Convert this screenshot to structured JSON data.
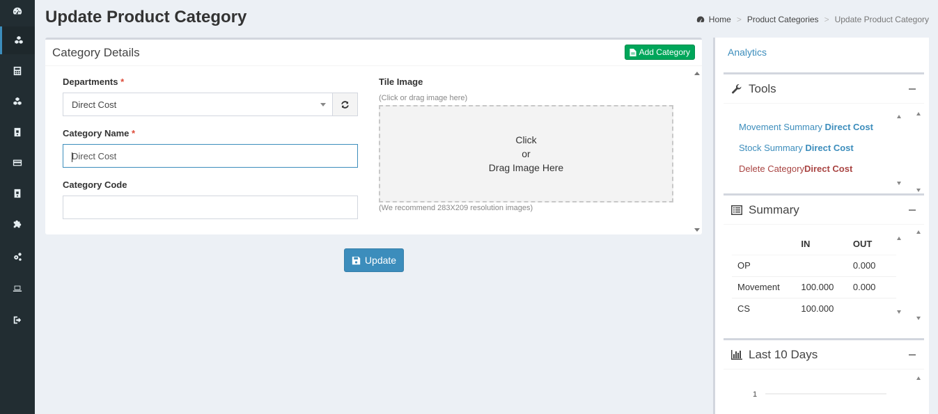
{
  "page": {
    "title": "Update Product Category"
  },
  "breadcrumb": {
    "home": "Home",
    "parent": "Product Categories",
    "current": "Update Product Category"
  },
  "sidebar": {
    "items": [
      {
        "icon": "dashboard-icon"
      },
      {
        "icon": "cubes-icon",
        "active": true
      },
      {
        "icon": "calculator-icon"
      },
      {
        "icon": "cubes-icon"
      },
      {
        "icon": "archive-icon"
      },
      {
        "icon": "credit-card-icon"
      },
      {
        "icon": "archive-icon"
      },
      {
        "icon": "puzzle-icon"
      },
      {
        "icon": "cogs-icon"
      },
      {
        "icon": "laptop-icon"
      },
      {
        "icon": "sign-out-icon"
      }
    ]
  },
  "form": {
    "box_title": "Category Details",
    "add_category_label": "Add Category",
    "departments_label": "Departments",
    "required_mark": "*",
    "departments_value": "Direct Cost",
    "category_name_label": "Category Name",
    "category_name_value": "Direct Cost",
    "category_code_label": "Category Code",
    "category_code_value": "",
    "tile_image_label": "Tile Image",
    "tile_hint": "(Click or drag image here)",
    "dropzone_line1": "Click",
    "dropzone_line2": "or",
    "dropzone_line3": "Drag Image Here",
    "tile_recommend": "(We recommend 283X209 resolution images)",
    "update_label": "Update"
  },
  "right_panel": {
    "analytics_label": "Analytics",
    "tools": {
      "title": "Tools",
      "movement_prefix": "Movement Summary ",
      "movement_name": "Direct Cost",
      "stock_prefix": "Stock Summary ",
      "stock_name": "Direct Cost",
      "delete_prefix": "Delete Category",
      "delete_name": "Direct Cost"
    },
    "summary": {
      "title": "Summary",
      "headers": [
        "",
        "IN",
        "OUT"
      ],
      "rows": [
        [
          "OP",
          "",
          "0.000"
        ],
        [
          "Movement",
          "100.000",
          "0.000"
        ],
        [
          "CS",
          "100.000",
          ""
        ]
      ]
    },
    "last10": {
      "title": "Last 10 Days",
      "visible_tick": "1"
    }
  },
  "colors": {
    "sidebar_bg": "#222d32",
    "primary": "#3c8dbc",
    "success": "#00a65a",
    "danger_text": "#a94442",
    "required": "#dd4b39"
  }
}
